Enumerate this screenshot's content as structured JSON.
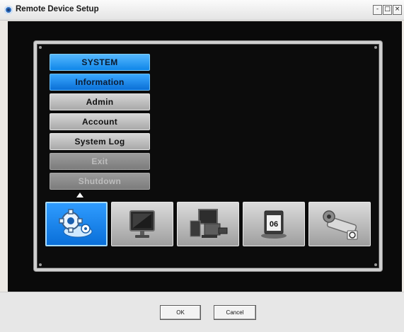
{
  "window": {
    "title": "Remote Device Setup",
    "controls": {
      "minimize": "-",
      "maximize": "□",
      "close": "×"
    }
  },
  "menu": {
    "header": "SYSTEM",
    "items": [
      {
        "label": "Information",
        "state": "active"
      },
      {
        "label": "Admin",
        "state": "normal"
      },
      {
        "label": "Account",
        "state": "normal"
      },
      {
        "label": "System Log",
        "state": "normal"
      },
      {
        "label": "Exit",
        "state": "disabled"
      },
      {
        "label": "Shutdown",
        "state": "disabled"
      }
    ]
  },
  "icon_bar": {
    "items": [
      {
        "icon": "system-gear-icon",
        "selected": true
      },
      {
        "icon": "display-monitor-icon",
        "selected": false
      },
      {
        "icon": "devices-icon",
        "selected": false
      },
      {
        "icon": "schedule-calendar-icon",
        "selected": false
      },
      {
        "icon": "network-camera-icon",
        "selected": false
      }
    ],
    "calendar_day": "06"
  },
  "dialog": {
    "ok": "OK",
    "cancel": "Cancel"
  },
  "colors": {
    "accent": "#0f86e8",
    "panel_bg": "#0c0c0c",
    "client_bg": "#0a0a0a"
  }
}
